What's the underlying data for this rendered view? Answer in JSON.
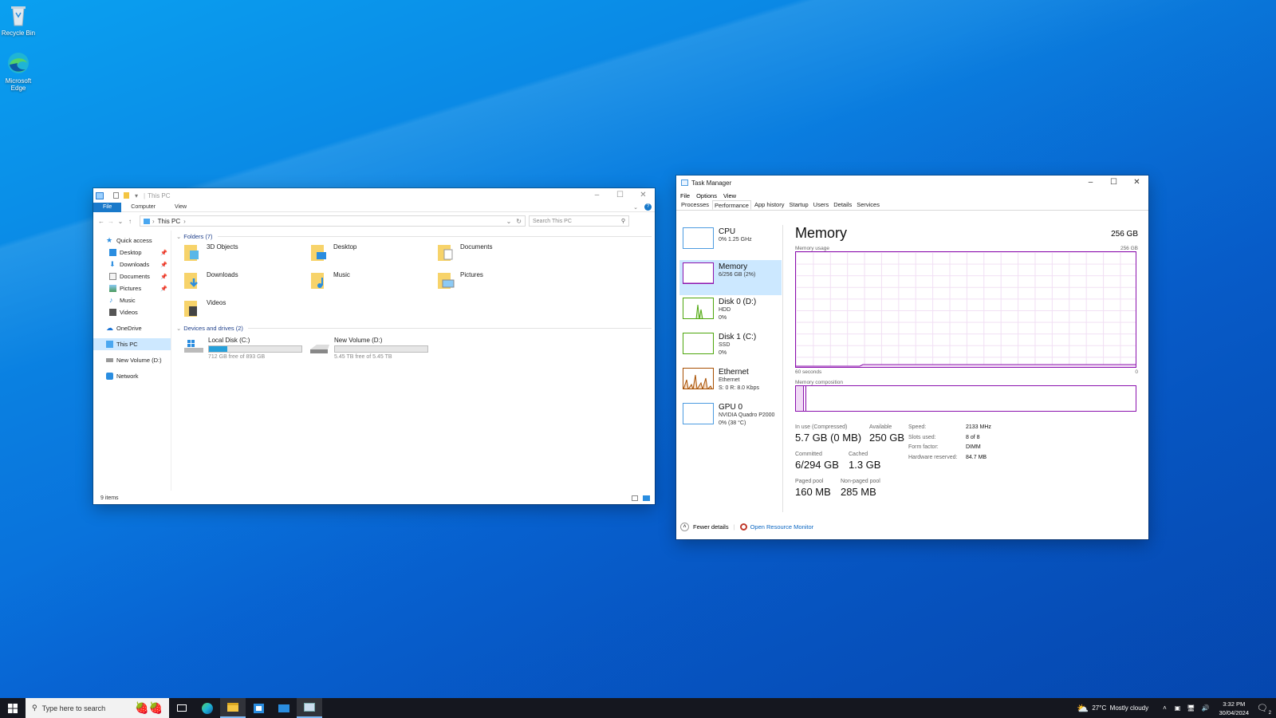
{
  "desktop": {
    "icons": [
      {
        "label": "Recycle Bin"
      },
      {
        "label": "Microsoft Edge"
      }
    ]
  },
  "explorer": {
    "title": "This PC",
    "ribbon_tabs": [
      "File",
      "Computer",
      "View"
    ],
    "address": "This PC",
    "search_placeholder": "Search This PC",
    "nav": {
      "quick_access": "Quick access",
      "quick_items": [
        "Desktop",
        "Downloads",
        "Documents",
        "Pictures",
        "Music",
        "Videos"
      ],
      "onedrive": "OneDrive",
      "this_pc": "This PC",
      "new_volume": "New Volume (D:)",
      "network": "Network"
    },
    "folders_header": "Folders (7)",
    "folders": [
      "3D Objects",
      "Desktop",
      "Documents",
      "Downloads",
      "Music",
      "Pictures",
      "Videos"
    ],
    "drives_header": "Devices and drives (2)",
    "drives": [
      {
        "name": "Local Disk (C:)",
        "free": "712 GB free of 893 GB",
        "used_fraction": 0.2
      },
      {
        "name": "New Volume (D:)",
        "free": "5.45 TB free of 5.45 TB",
        "used_fraction": 0.0
      }
    ],
    "status": "9 items"
  },
  "taskmgr": {
    "title": "Task Manager",
    "menu": [
      "File",
      "Options",
      "View"
    ],
    "tabs": [
      "Processes",
      "Performance",
      "App history",
      "Startup",
      "Users",
      "Details",
      "Services"
    ],
    "resources": [
      {
        "name": "CPU",
        "sub1": "0% 1.25 GHz",
        "sub2": ""
      },
      {
        "name": "Memory",
        "sub1": "6/256 GB (2%)",
        "sub2": ""
      },
      {
        "name": "Disk 0 (D:)",
        "sub1": "HDD",
        "sub2": "0%"
      },
      {
        "name": "Disk 1 (C:)",
        "sub1": "SSD",
        "sub2": "0%"
      },
      {
        "name": "Ethernet",
        "sub1": "Ethernet",
        "sub2": "S: 0 R: 8.0 Kbps"
      },
      {
        "name": "GPU 0",
        "sub1": "NVIDIA Quadro P2000",
        "sub2": "0% (38 °C)"
      }
    ],
    "memory": {
      "heading": "Memory",
      "total": "256 GB",
      "usage_label": "Memory usage",
      "usage_max": "256 GB",
      "time_label": "60 seconds",
      "time_end": "0",
      "composition_label": "Memory composition",
      "in_use_label": "In use (Compressed)",
      "in_use": "5.7 GB (0 MB)",
      "available_label": "Available",
      "available": "250 GB",
      "committed_label": "Committed",
      "committed": "6/294 GB",
      "cached_label": "Cached",
      "cached": "1.3 GB",
      "paged_label": "Paged pool",
      "paged": "160 MB",
      "nonpaged_label": "Non-paged pool",
      "nonpaged": "285 MB",
      "speed_label": "Speed:",
      "speed": "2133 MHz",
      "slots_label": "Slots used:",
      "slots": "8 of 8",
      "form_label": "Form factor:",
      "form": "DIMM",
      "hwres_label": "Hardware reserved:",
      "hwres": "84.7 MB"
    },
    "footer": {
      "fewer": "Fewer details",
      "monitor": "Open Resource Monitor"
    }
  },
  "taskbar": {
    "search_placeholder": "Type here to search",
    "weather": "27°C  Mostly cloudy",
    "time": "3:32 PM",
    "date": "30/04/2024",
    "notifications": "2"
  },
  "colors": {
    "accent": "#1979ca",
    "memory_purple": "#8b12ae",
    "taskbar": "#15171f"
  }
}
